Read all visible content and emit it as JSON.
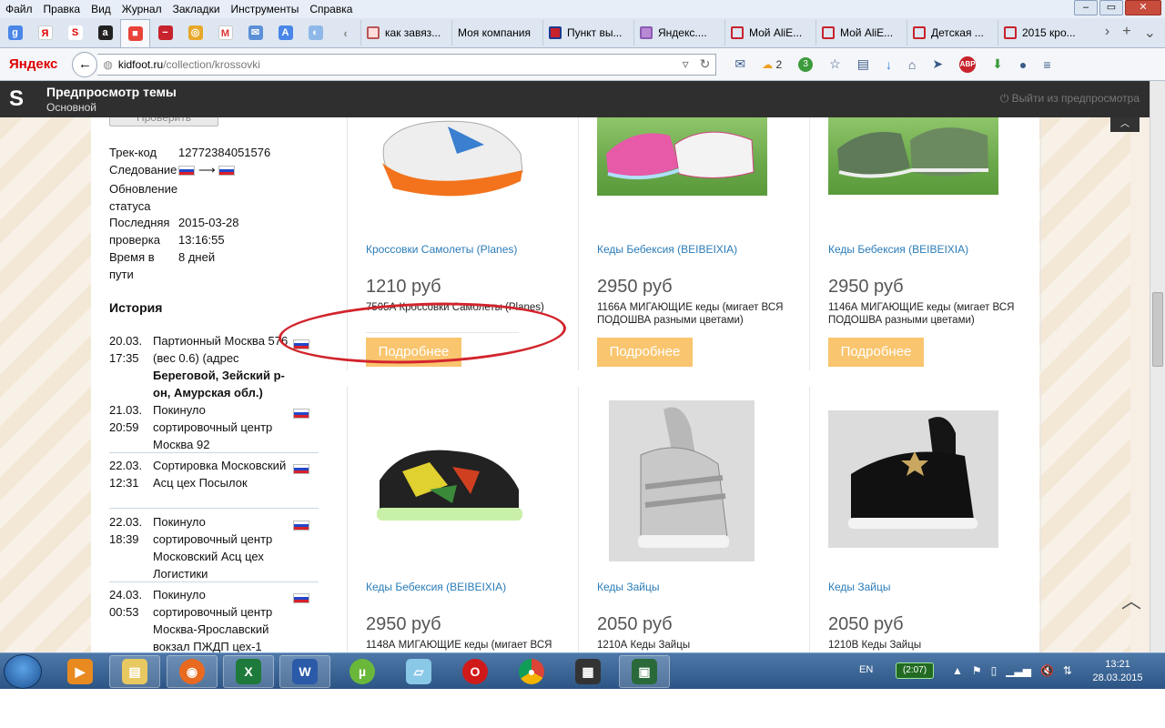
{
  "menubar": {
    "items": [
      "Файл",
      "Правка",
      "Вид",
      "Журнал",
      "Закладки",
      "Инструменты",
      "Справка"
    ]
  },
  "tabs": [
    {
      "label": "как завяз..."
    },
    {
      "label": "Моя компания"
    },
    {
      "label": "Пункт вы..."
    },
    {
      "label": "Яндекс...."
    },
    {
      "label": "Мой AliE..."
    },
    {
      "label": "Мой AliE..."
    },
    {
      "label": "Детская ..."
    },
    {
      "label": "2015 кро..."
    }
  ],
  "navbar": {
    "logo": "Яндекс",
    "url_host": "kidfoot.ru",
    "url_path": "/collection/krossovki",
    "weather_count": "2",
    "badge_count": "3",
    "abp": "ABP"
  },
  "preview": {
    "title": "Предпросмотр темы",
    "subtitle": "Основной",
    "exit": "Выйти из предпросмотра"
  },
  "tracking": {
    "check_button": "Проверить",
    "track_label": "Трек-код",
    "track_value": "12772384051576",
    "follow_label": "Следование",
    "status_label": "Обновление статуса",
    "last_check_label": "Последняя проверка",
    "last_check_date": "2015-03-28",
    "last_check_time": "13:16:55",
    "travel_label": "Время в пути",
    "travel_value": "8 дней",
    "history_title": "История",
    "history": [
      {
        "date": "20.03.",
        "time": "17:35",
        "text": "Партионный Москва 576 (вес 0.6) (адрес",
        "bold": "Береговой, Зейский р-он, Амурская обл.)"
      },
      {
        "date": "21.03.",
        "time": "20:59",
        "text": "Покинуло сортировочный центр Москва 92",
        "bold": ""
      },
      {
        "date": "22.03.",
        "time": "12:31",
        "text": "Сортировка Московский Асц цех Посылок",
        "bold": ""
      },
      {
        "date": "22.03.",
        "time": "18:39",
        "text": "Покинуло сортировочный центр Московский Асц цех Логистики",
        "bold": ""
      },
      {
        "date": "24.03.",
        "time": "00:53",
        "text": "Покинуло сортировочный центр Москва-Ярославский вокзал ПЖДП цех-1",
        "bold": ""
      }
    ]
  },
  "products": [
    {
      "name": "Кроссовки Самолеты (Planes)",
      "price": "1210 руб",
      "desc": "7505А Кроссовки Самолеты (Planes)",
      "button": "Подробнее"
    },
    {
      "name": "Кеды Бебексия (BEIBEIXIA)",
      "price": "2950 руб",
      "desc": "1166А МИГАЮЩИЕ кеды (мигает ВСЯ ПОДОШВА разными цветами)",
      "button": "Подробнее"
    },
    {
      "name": "Кеды Бебексия (BEIBEIXIA)",
      "price": "2950 руб",
      "desc": "1146А МИГАЮЩИЕ кеды (мигает ВСЯ ПОДОШВА разными цветами)",
      "button": "Подробнее"
    },
    {
      "name": "Кеды Бебексия (BEIBEIXIA)",
      "price": "2950 руб",
      "desc": "1148А МИГАЮЩИЕ кеды (мигает ВСЯ",
      "button": ""
    },
    {
      "name": "Кеды Зайцы",
      "price": "2050 руб",
      "desc": "1210А Кеды Зайцы",
      "button": ""
    },
    {
      "name": "Кеды Зайцы",
      "price": "2050 руб",
      "desc": "1210В Кеды Зайцы",
      "button": ""
    }
  ],
  "taskbar": {
    "lang": "EN",
    "battery": "(2:07)",
    "time": "13:21",
    "date": "28.03.2015"
  },
  "colors": {
    "link": "#2a7cb9",
    "button": "#f9c56e",
    "annotation": "#d2242c",
    "preview_bar": "#2f2f2f"
  }
}
